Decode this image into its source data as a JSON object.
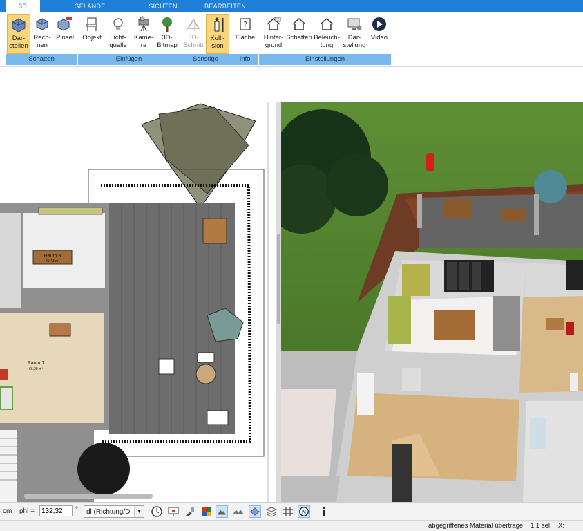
{
  "tabs": [
    "3D",
    "GELÄNDE",
    "SICHTEN",
    "BEARBEITEN"
  ],
  "ribbon": {
    "buttons": [
      {
        "label": "Dar-\nstellen",
        "icon": "cube-render-icon"
      },
      {
        "label": "Rech-\nnen",
        "icon": "cube-compute-icon"
      },
      {
        "label": "Pinsel",
        "icon": "brush-cube-icon"
      },
      {
        "label": "Objekt",
        "icon": "chair-icon"
      },
      {
        "label": "Licht-\nquelle",
        "icon": "lightbulb-icon"
      },
      {
        "label": "Kame-\nra",
        "icon": "camera-icon"
      },
      {
        "label": "3D-\nBitmap",
        "icon": "tree-icon"
      },
      {
        "label": "3D-\nSchnitt",
        "icon": "section-icon"
      },
      {
        "label": "Kolli-\nsion",
        "icon": "person-collision-icon"
      },
      {
        "label": "Fläche",
        "icon": "area-info-icon"
      },
      {
        "label": "Hinter-\ngrund",
        "icon": "house-background-icon"
      },
      {
        "label": "Schatten",
        "icon": "house-shadow-icon"
      },
      {
        "label": "Beleuch-\ntung",
        "icon": "house-light-icon"
      },
      {
        "label": "Dar-\nstellung",
        "icon": "monitor-settings-icon"
      },
      {
        "label": "Video",
        "icon": "play-circle-icon"
      }
    ],
    "groups": [
      "Schatten",
      "Einfügen",
      "Sonstige",
      "Info",
      "Einstellungen"
    ]
  },
  "plan": {
    "rooms": [
      {
        "name": "Raum 3",
        "area": "45,43 m²"
      },
      {
        "name": "Raum 1",
        "area": "66,29 m²"
      }
    ]
  },
  "toolbar": {
    "unit": "cm",
    "phi_label": "phi =",
    "phi_value": "132,32",
    "deg": "°",
    "direction_select": "dl (Richtung/Di",
    "icons": [
      "clock-icon",
      "presentation-icon",
      "brush-icon",
      "palette-icon",
      "mountain-view-icon",
      "double-mountain-icon",
      "layer-diamond-icon",
      "layers-icon",
      "grid-icon",
      "north-icon",
      "info-icon"
    ]
  },
  "status": {
    "message": "abgegriffenes Material übertrage",
    "scale": "1:1 sel",
    "coord_label": "X:"
  }
}
